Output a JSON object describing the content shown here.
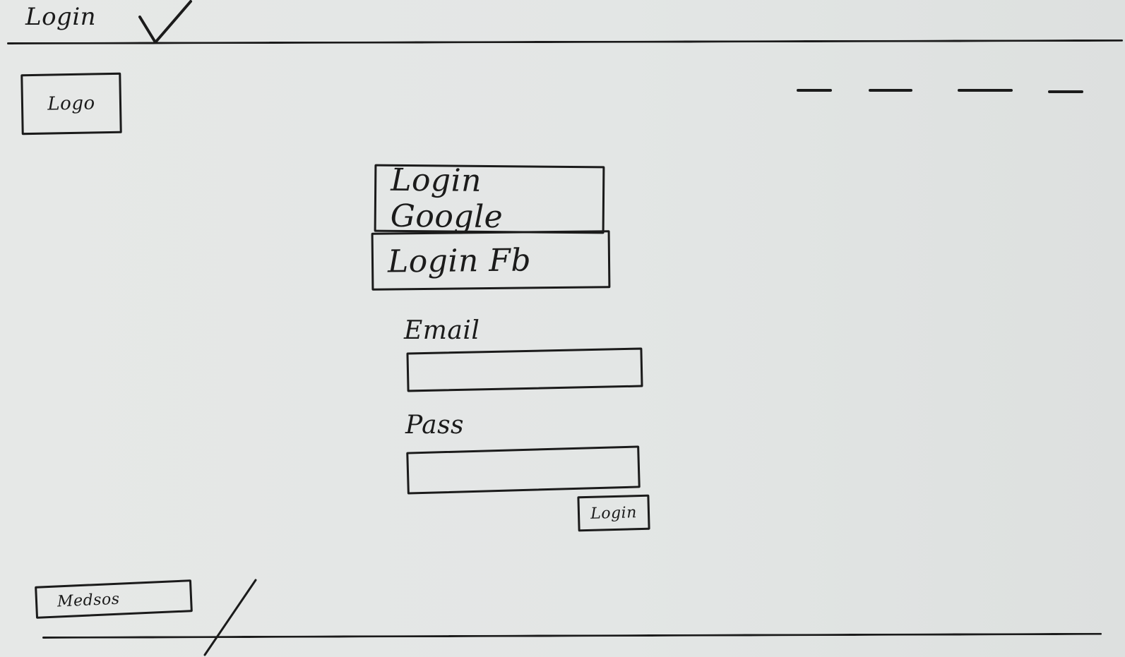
{
  "header": {
    "title": "Login",
    "check_icon": "checkmark-icon"
  },
  "logo": {
    "label": "Logo"
  },
  "nav": {
    "items": [
      "—",
      "—",
      "—",
      "—"
    ]
  },
  "social_login": {
    "google_label": "Login Google",
    "facebook_label": "Login Fb"
  },
  "form": {
    "email_label": "Email",
    "email_value": "",
    "email_placeholder": "",
    "password_label": "Pass",
    "password_value": "",
    "password_placeholder": "",
    "submit_label": "Login"
  },
  "footer": {
    "box_label": "Medsos"
  },
  "colors": {
    "ink": "#1b1b1b",
    "paper": "#e4e7e6"
  }
}
